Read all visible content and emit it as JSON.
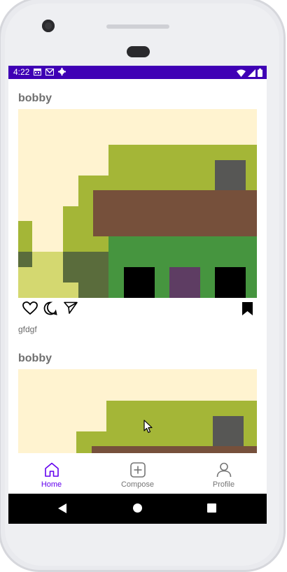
{
  "status": {
    "time": "4:22",
    "left_icons": [
      "calendar-icon",
      "gmail-icon",
      "settings-icon"
    ],
    "right_icons": [
      "wifi-icon",
      "signal-icon",
      "battery-icon"
    ]
  },
  "posts": [
    {
      "username": "bobby",
      "caption": "gfdgf"
    },
    {
      "username": "bobby",
      "caption": ""
    }
  ],
  "actions": [
    "heart-icon",
    "comment-icon",
    "send-icon",
    "bookmark-icon"
  ],
  "bottom_nav": {
    "items": [
      {
        "label": "Home",
        "icon": "home-icon",
        "active": true
      },
      {
        "label": "Compose",
        "icon": "plus-square-icon",
        "active": false
      },
      {
        "label": "Profile",
        "icon": "person-icon",
        "active": false
      }
    ]
  },
  "colors": {
    "status_bar": "#3f00b5",
    "accent": "#6200ee",
    "sky": "#fff3d0",
    "lime": "#a4b637",
    "pale_lime": "#d4d870",
    "olive": "#5a6c3c",
    "dark_olive": "#5b6441",
    "brown": "#76503b",
    "green": "#46953f",
    "grey": "#575755",
    "purple": "#5e3d63",
    "black": "#000000"
  }
}
